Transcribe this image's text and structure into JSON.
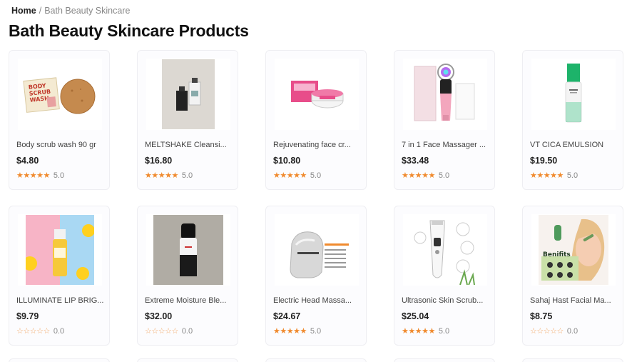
{
  "breadcrumb": {
    "home": "Home",
    "separator": "/",
    "current": "Bath Beauty Skincare"
  },
  "page_title": "Bath Beauty Skincare Products",
  "colors": {
    "star": "#f08a2e",
    "accent_text": "#222222"
  },
  "products": [
    {
      "name": "Body scrub wash 90 gr",
      "price": "$4.80",
      "stars": "★★★★★",
      "rating": "5.0",
      "rated": true
    },
    {
      "name": "MELTSHAKE Cleansi...",
      "price": "$16.80",
      "stars": "★★★★★",
      "rating": "5.0",
      "rated": true
    },
    {
      "name": "Rejuvenating face cr...",
      "price": "$10.80",
      "stars": "★★★★★",
      "rating": "5.0",
      "rated": true
    },
    {
      "name": "7 in 1 Face Massager ...",
      "price": "$33.48",
      "stars": "★★★★★",
      "rating": "5.0",
      "rated": true
    },
    {
      "name": "VT CICA EMULSION",
      "price": "$19.50",
      "stars": "★★★★★",
      "rating": "5.0",
      "rated": true
    },
    {
      "name": "ILLUMINATE LIP BRIG...",
      "price": "$9.79",
      "stars": "☆☆☆☆☆",
      "rating": "0.0",
      "rated": false
    },
    {
      "name": "Extreme Moisture Ble...",
      "price": "$32.00",
      "stars": "☆☆☆☆☆",
      "rating": "0.0",
      "rated": false
    },
    {
      "name": "Electric Head Massa...",
      "price": "$24.67",
      "stars": "★★★★★",
      "rating": "5.0",
      "rated": true
    },
    {
      "name": "Ultrasonic Skin Scrub...",
      "price": "$25.04",
      "stars": "★★★★★",
      "rating": "5.0",
      "rated": true
    },
    {
      "name": "Sahaj Hast Facial Ma...",
      "price": "$8.75",
      "stars": "☆☆☆☆☆",
      "rating": "0.0",
      "rated": false
    }
  ]
}
